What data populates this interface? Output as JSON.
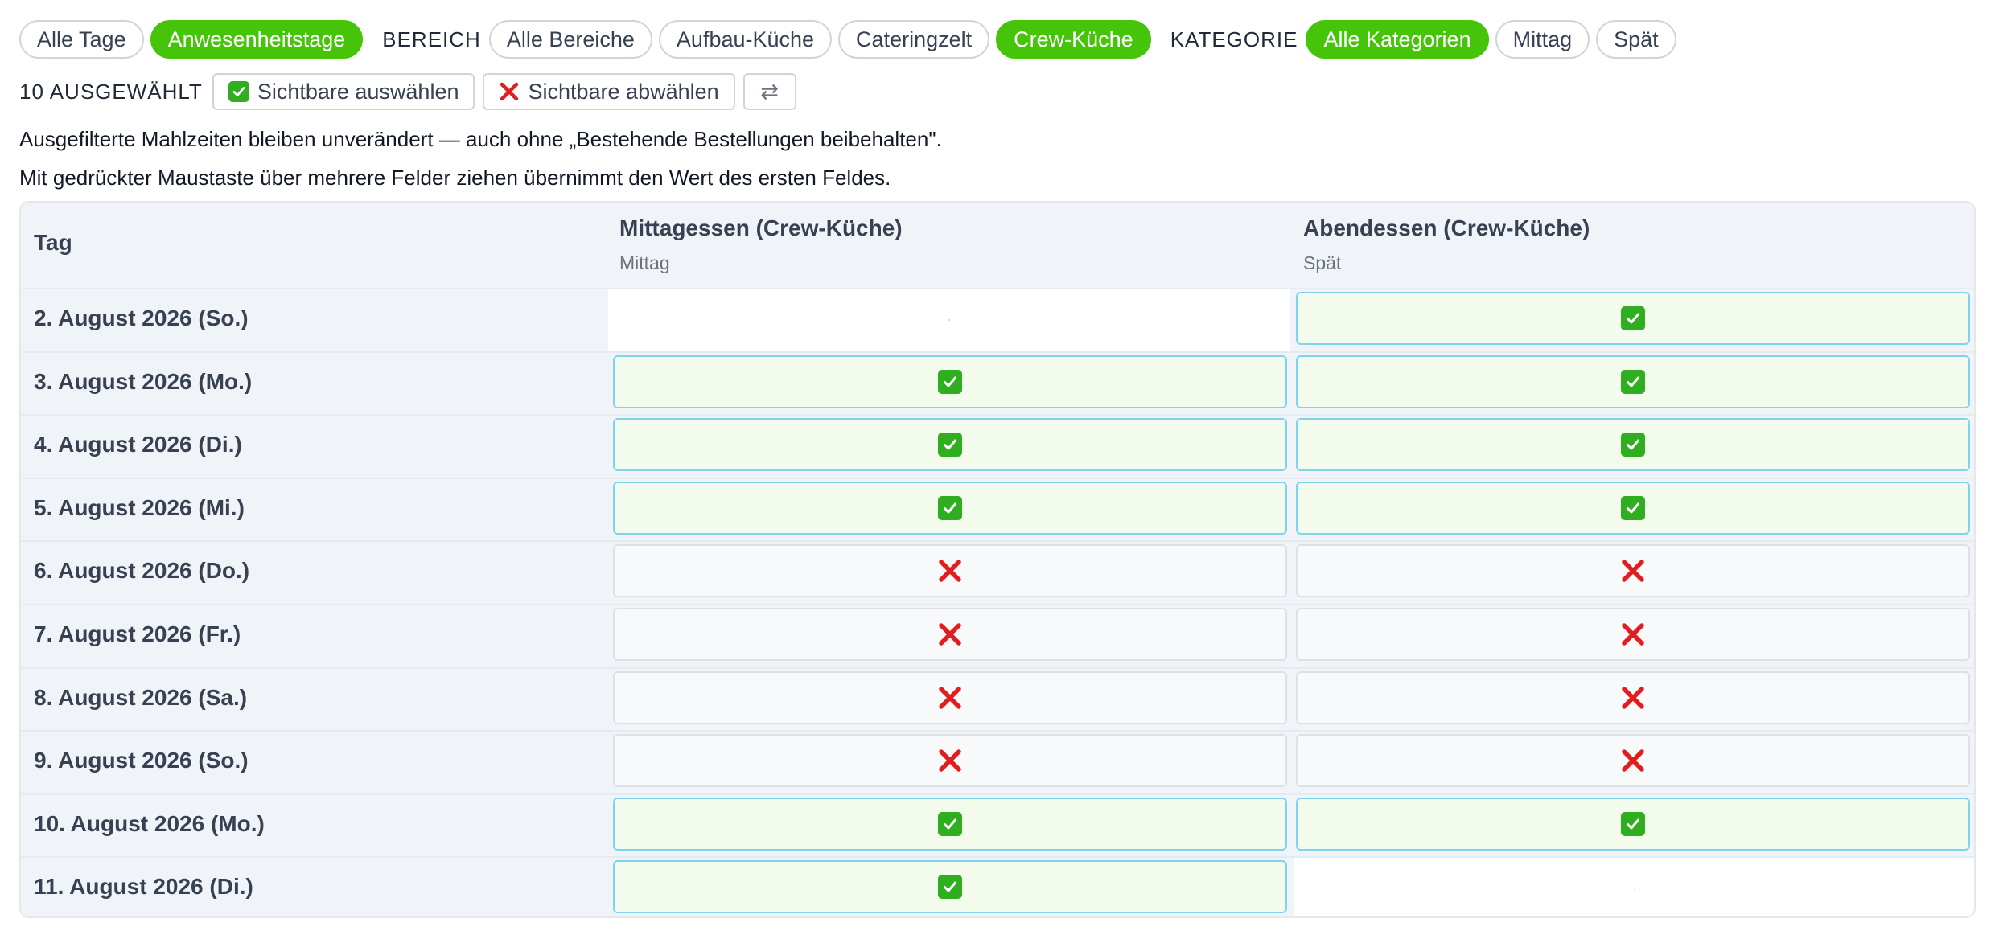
{
  "filters": {
    "days": [
      {
        "label": "Alle Tage",
        "active": false
      },
      {
        "label": "Anwesenheitstage",
        "active": true
      }
    ],
    "area_label": "BEREICH",
    "areas": [
      {
        "label": "Alle Bereiche",
        "active": false
      },
      {
        "label": "Aufbau-Küche",
        "active": false
      },
      {
        "label": "Cateringzelt",
        "active": false
      },
      {
        "label": "Crew-Küche",
        "active": true
      }
    ],
    "category_label": "KATEGORIE",
    "categories": [
      {
        "label": "Alle Kategorien",
        "active": true
      },
      {
        "label": "Mittag",
        "active": false
      },
      {
        "label": "Spät",
        "active": false
      }
    ]
  },
  "selection": {
    "count_label": "10 AUSGEWÄHLT",
    "select_visible": "Sichtbare auswählen",
    "deselect_visible": "Sichtbare abwählen",
    "swap_icon": "⇄"
  },
  "info": {
    "line1": "Ausgefilterte Mahlzeiten bleiben unverändert — auch ohne „Bestehende Bestellungen beibehalten\".",
    "line2": "Mit gedrückter Maustaste über mehrere Felder ziehen übernimmt den Wert des ersten Feldes."
  },
  "table": {
    "day_header": "Tag",
    "meals": [
      {
        "title": "Mittagessen (Crew-Küche)",
        "category": "Mittag"
      },
      {
        "title": "Abendessen (Crew-Küche)",
        "category": "Spät"
      }
    ],
    "rows": [
      {
        "day": "2. August 2026 (So.)",
        "cells": [
          "none",
          "on"
        ]
      },
      {
        "day": "3. August 2026 (Mo.)",
        "cells": [
          "on",
          "on"
        ]
      },
      {
        "day": "4. August 2026 (Di.)",
        "cells": [
          "on",
          "on"
        ]
      },
      {
        "day": "5. August 2026 (Mi.)",
        "cells": [
          "on",
          "on"
        ]
      },
      {
        "day": "6. August 2026 (Do.)",
        "cells": [
          "off",
          "off"
        ]
      },
      {
        "day": "7. August 2026 (Fr.)",
        "cells": [
          "off",
          "off"
        ]
      },
      {
        "day": "8. August 2026 (Sa.)",
        "cells": [
          "off",
          "off"
        ]
      },
      {
        "day": "9. August 2026 (So.)",
        "cells": [
          "off",
          "off"
        ]
      },
      {
        "day": "10. August 2026 (Mo.)",
        "cells": [
          "on",
          "on"
        ]
      },
      {
        "day": "11. August 2026 (Di.)",
        "cells": [
          "on",
          "none"
        ]
      }
    ]
  },
  "colors": {
    "accent_green": "#45c40a",
    "check_green": "#2fae1f",
    "cross_red": "#e11d1d",
    "selected_border": "#7dd3f0"
  }
}
